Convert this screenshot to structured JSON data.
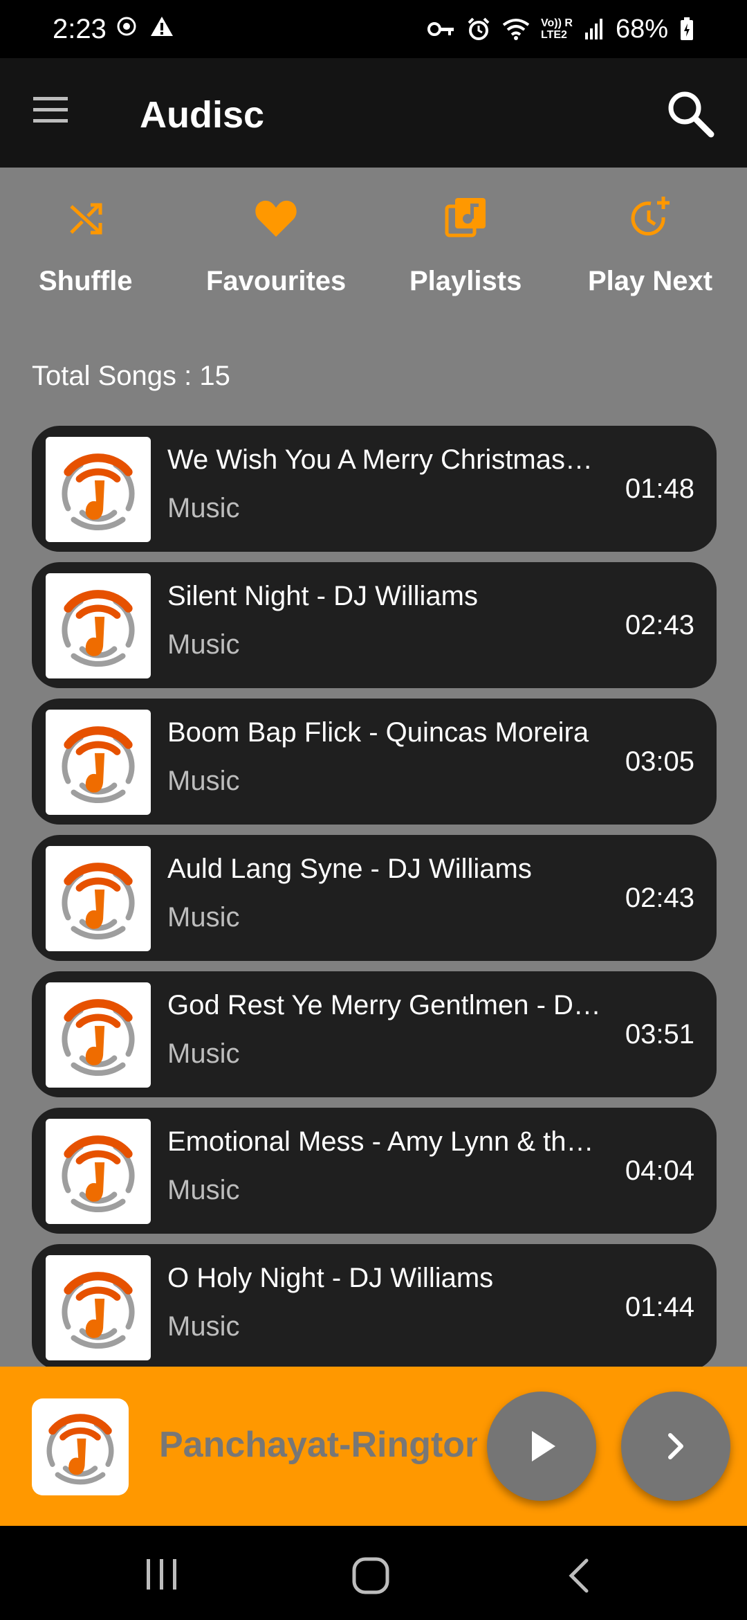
{
  "status_bar": {
    "time": "2:23",
    "battery_percent": "68%",
    "network_label_top": "Vo)) R",
    "network_label_bottom": "LTE2",
    "icons": [
      "whatsapp-icon",
      "alert-icon",
      "vpn-key-icon",
      "alarm-icon",
      "wifi-icon",
      "signal-icon",
      "battery-icon"
    ]
  },
  "app_bar": {
    "title": "Audisc",
    "icons": [
      "menu-icon",
      "search-icon"
    ]
  },
  "quick_actions": [
    {
      "label": "Shuffle",
      "icon": "shuffle-icon"
    },
    {
      "label": "Favourites",
      "icon": "heart-icon"
    },
    {
      "label": "Playlists",
      "icon": "playlist-icon"
    },
    {
      "label": "Play Next",
      "icon": "play-next-icon"
    }
  ],
  "total_songs_label": "Total Songs : 15",
  "songs": [
    {
      "title": "We Wish You A Merry Christmas…",
      "subtitle": "Music",
      "duration": "01:48"
    },
    {
      "title": "Silent Night - DJ Williams",
      "subtitle": "Music",
      "duration": "02:43"
    },
    {
      "title": "Boom Bap Flick - Quincas Moreira",
      "subtitle": "Music",
      "duration": "03:05"
    },
    {
      "title": "Auld Lang Syne - DJ Williams",
      "subtitle": "Music",
      "duration": "02:43"
    },
    {
      "title": "God Rest Ye Merry Gentlmen - D…",
      "subtitle": "Music",
      "duration": "03:51"
    },
    {
      "title": "Emotional Mess - Amy Lynn & th…",
      "subtitle": "Music",
      "duration": "04:04"
    },
    {
      "title": "O Holy Night - DJ Williams",
      "subtitle": "Music",
      "duration": "01:44"
    }
  ],
  "now_playing": {
    "title": "Panchayat-Ringtone",
    "icons": [
      "play-icon",
      "next-icon"
    ]
  },
  "nav_bar": {
    "icons": [
      "recent-apps-icon",
      "home-icon",
      "back-icon"
    ]
  },
  "colors": {
    "accent": "#FF9800",
    "app_bar": "#141414",
    "background": "#808080",
    "card": "#1F1F1F"
  }
}
